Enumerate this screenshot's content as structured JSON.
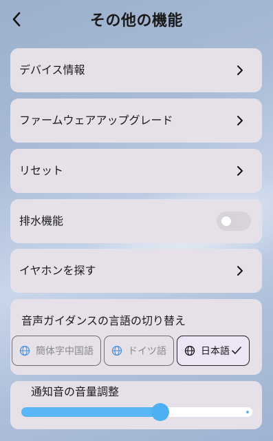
{
  "header": {
    "title": "その他の機能"
  },
  "rows": [
    {
      "label": "デバイス情報"
    },
    {
      "label": "ファームウェアアップグレード"
    },
    {
      "label": "リセット"
    },
    {
      "label": "排水機能",
      "toggle": false
    },
    {
      "label": "イヤホンを探す"
    }
  ],
  "language": {
    "title": "音声ガイダンスの言語の切り替え",
    "options": [
      "簡体字中国語",
      "ドイツ語",
      "日本語"
    ],
    "selected": "日本語"
  },
  "volume": {
    "title": "通知音の音量調整",
    "level": 0.6
  },
  "colors": {
    "accent": "#4cb0f2",
    "card": "#e6e1e9"
  }
}
